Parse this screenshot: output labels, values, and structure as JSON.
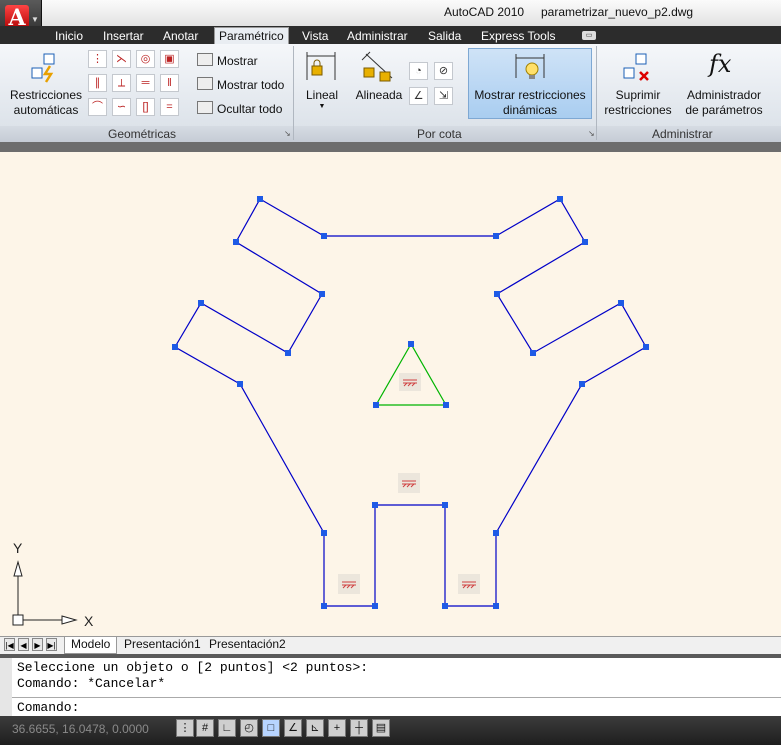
{
  "window": {
    "app_title": "AutoCAD 2010",
    "file_title": "parametrizar_nuevo_p2.dwg"
  },
  "app_button": {
    "logo": "A",
    "icon": "autocad-logo-icon"
  },
  "tabs": [
    {
      "label": "Inicio"
    },
    {
      "label": "Insertar"
    },
    {
      "label": "Anotar"
    },
    {
      "label": "Paramétrico",
      "active": true
    },
    {
      "label": "Vista"
    },
    {
      "label": "Administrar"
    },
    {
      "label": "Salida"
    },
    {
      "label": "Express Tools"
    }
  ],
  "ribbon": {
    "geometricas": {
      "panel_label": "Geométricas",
      "auto_line1": "Restricciones",
      "auto_line2": "automáticas",
      "mostrar": "Mostrar",
      "mostrar_todo": "Mostrar todo",
      "ocultar_todo": "Ocultar todo"
    },
    "por_cota": {
      "panel_label": "Por cota",
      "lineal": "Lineal",
      "alineada": "Alineada",
      "dyn_line1": "Mostrar restricciones",
      "dyn_line2": "dinámicas"
    },
    "administrar": {
      "panel_label": "Administrar",
      "suprimir_line1": "Suprimir",
      "suprimir_line2": "restricciones",
      "admin_line1": "Administrador",
      "admin_line2": "de parámetros",
      "fx": "fx"
    }
  },
  "canvas": {
    "ucs_x": "X",
    "ucs_y": "Y",
    "shape_color": "#0000c8",
    "triangle_color": "#00b400",
    "grip_color": "#1e5ae6"
  },
  "layout_tabs": [
    "Modelo",
    "Presentación1",
    "Presentación2"
  ],
  "command": {
    "line1": "Seleccione un objeto o [2 puntos] <2 puntos>:",
    "line2": "Comando: *Cancelar*",
    "prompt": "Comando:"
  },
  "status": {
    "coords": "36.6655, 16.0478, 0.0000"
  }
}
